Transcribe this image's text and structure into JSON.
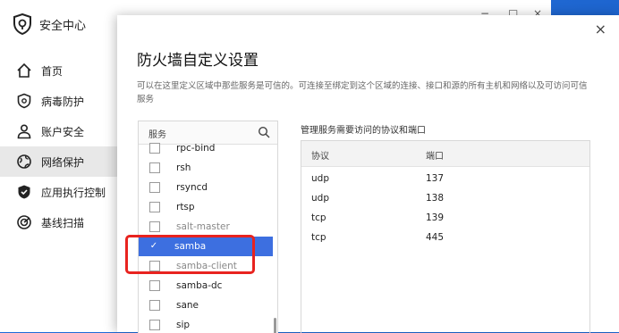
{
  "app": {
    "title": "安全中心",
    "window_controls": [
      "−",
      "□",
      "×"
    ]
  },
  "nav": {
    "items": [
      {
        "label": "首页",
        "icon": "home-icon"
      },
      {
        "label": "病毒防护",
        "icon": "virus-shield-icon"
      },
      {
        "label": "账户安全",
        "icon": "user-icon"
      },
      {
        "label": "网络保护",
        "icon": "globe-icon",
        "active": true
      },
      {
        "label": "应用执行控制",
        "icon": "app-shield-icon"
      },
      {
        "label": "基线扫描",
        "icon": "scan-icon"
      }
    ]
  },
  "dialog": {
    "title": "防火墙自定义设置",
    "close": "×",
    "description": "可以在这里定义区域中那些服务是可信的。可连接至绑定到这个区域的连接、接口和源的所有主机和网络以及可访问可信服务",
    "services_header": "服务",
    "services": [
      {
        "name": "rpc-bind",
        "checked": false
      },
      {
        "name": "rsh",
        "checked": false
      },
      {
        "name": "rsyncd",
        "checked": false
      },
      {
        "name": "rtsp",
        "checked": false
      },
      {
        "name": "salt-master",
        "checked": false
      },
      {
        "name": "samba",
        "checked": true
      },
      {
        "name": "samba-client",
        "checked": false
      },
      {
        "name": "samba-dc",
        "checked": false
      },
      {
        "name": "sane",
        "checked": false
      },
      {
        "name": "sip",
        "checked": false
      }
    ],
    "check_mark": "✓",
    "ports_title": "管理服务需要访问的协议和端口",
    "ports_columns": {
      "protocol": "协议",
      "port": "端口"
    },
    "ports": [
      {
        "protocol": "udp",
        "port": "137"
      },
      {
        "protocol": "udp",
        "port": "138"
      },
      {
        "protocol": "tcp",
        "port": "139"
      },
      {
        "protocol": "tcp",
        "port": "445"
      }
    ]
  }
}
